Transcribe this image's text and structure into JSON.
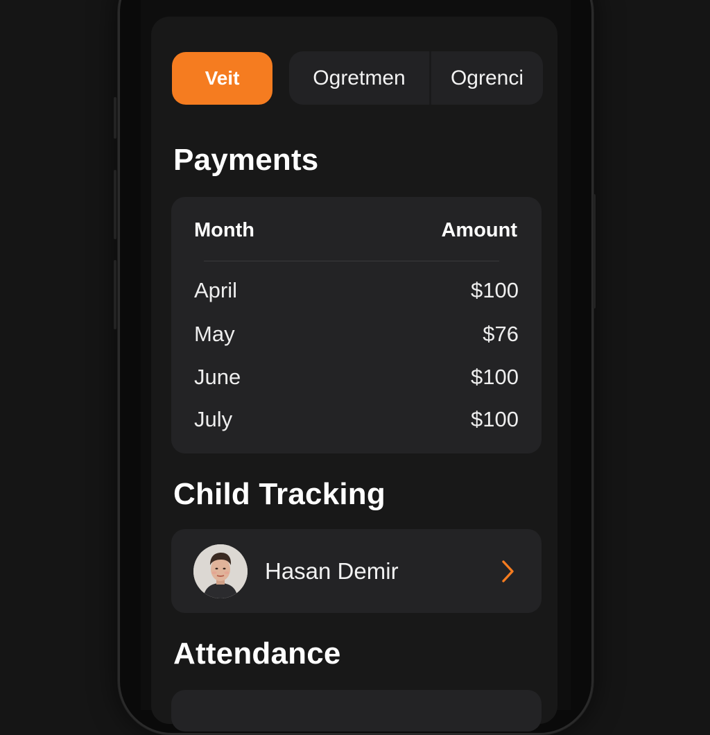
{
  "tabs": {
    "active_label": "Veit",
    "items": [
      "Ogretmen",
      "Ogrenci"
    ]
  },
  "payments": {
    "title": "Payments",
    "header_month": "Month",
    "header_amount": "Amount",
    "rows": [
      {
        "month": "April",
        "amount": "$100"
      },
      {
        "month": "May",
        "amount": "$76"
      },
      {
        "month": "June",
        "amount": "$100"
      },
      {
        "month": "July",
        "amount": "$100"
      }
    ]
  },
  "child_tracking": {
    "title": "Child Tracking",
    "child_name": "Hasan Demir",
    "avatar_icon": "person-photo",
    "chevron_icon": "chevron-right-icon"
  },
  "attendance": {
    "title": "Attendance"
  },
  "colors": {
    "accent": "#f57c20",
    "background": "#151515",
    "surface": "#181818",
    "card": "#232325",
    "text": "#ffffff"
  }
}
